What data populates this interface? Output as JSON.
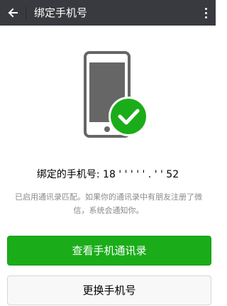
{
  "header": {
    "title": "绑定手机号",
    "back_icon": "arrow-left-icon",
    "more_icon": "more-vertical-icon"
  },
  "illustration": {
    "phone_icon": "smartphone-icon",
    "check_icon": "check-circle-icon",
    "accent_color": "#1aad19"
  },
  "main": {
    "phone_line": "绑定的手机号: 18 ' ' ' ' ' . ' ' 52",
    "hint": "已启用通讯录匹配。如果你的通讯录中有朋友注册了微信，系统会通知你。"
  },
  "actions": {
    "view_contacts_label": "查看手机通讯录",
    "change_phone_label": "更换手机号"
  }
}
